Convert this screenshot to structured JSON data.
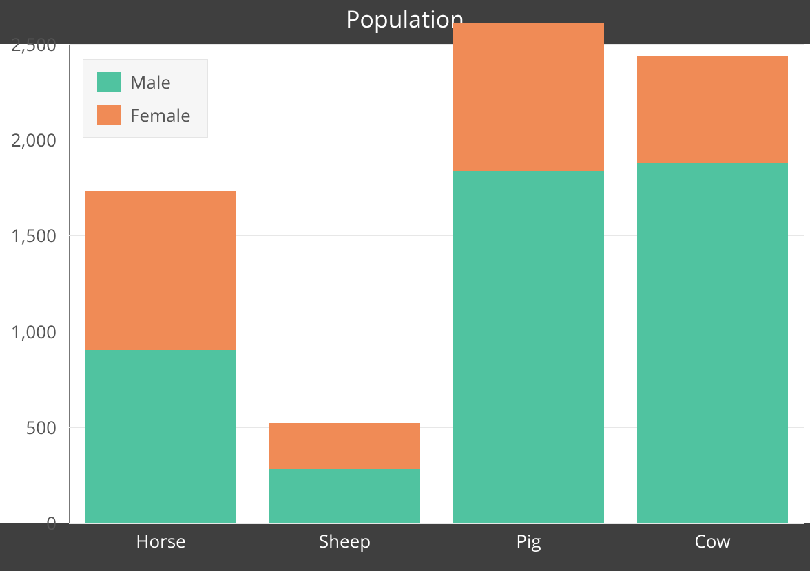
{
  "chart_data": {
    "type": "bar",
    "stacked": true,
    "title": "Population",
    "xlabel": "",
    "ylabel": "",
    "ylim": [
      0,
      2500
    ],
    "yticks": [
      0,
      500,
      1000,
      1500,
      2000,
      2500
    ],
    "categories": [
      "Horse",
      "Sheep",
      "Pig",
      "Cow"
    ],
    "series": [
      {
        "name": "Male",
        "values": [
          900,
          280,
          1840,
          1880
        ],
        "color": "#50c3a0"
      },
      {
        "name": "Female",
        "values": [
          830,
          240,
          770,
          560
        ],
        "color": "#f08b56"
      }
    ],
    "legend_position": "top-left"
  },
  "legend": {
    "items": [
      {
        "label": "Male",
        "color": "#50c3a0"
      },
      {
        "label": "Female",
        "color": "#f08b56"
      }
    ]
  }
}
